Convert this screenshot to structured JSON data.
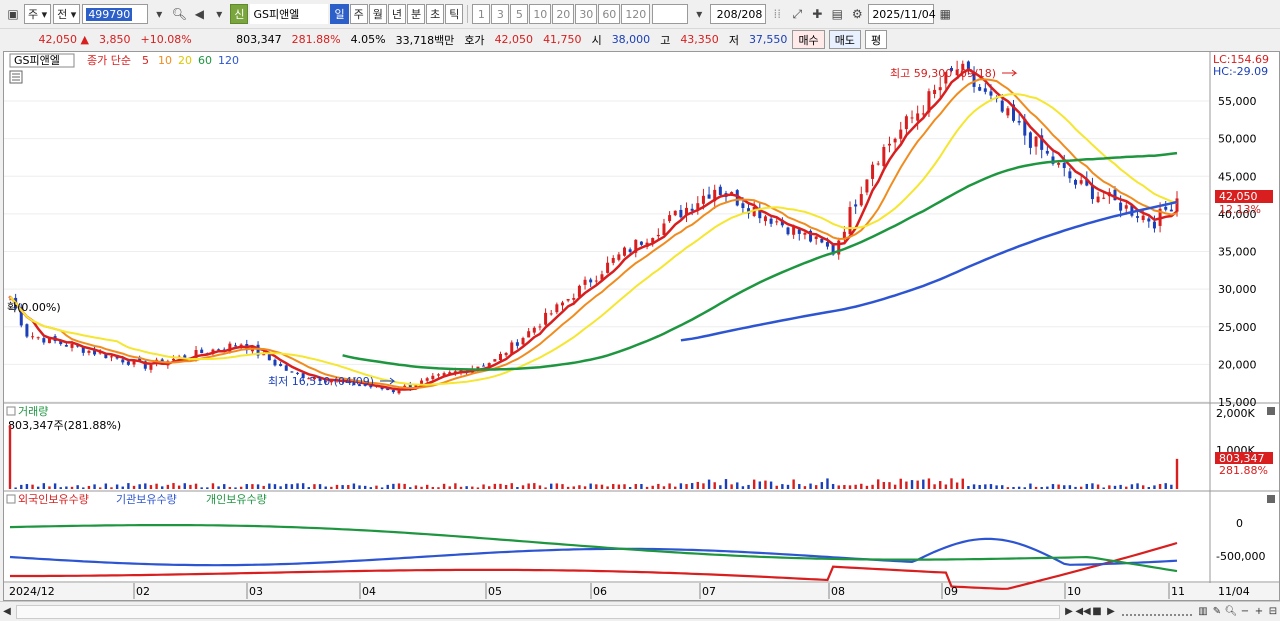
{
  "toolbar": {
    "period_btn": "주",
    "market_btn": "전",
    "stock_code": "499790",
    "new_badge": "신",
    "stock_name": "GS피앤엘",
    "tf_buttons": [
      {
        "label": "일",
        "active": true
      },
      {
        "label": "주",
        "active": false
      },
      {
        "label": "월",
        "active": false
      },
      {
        "label": "년",
        "active": false
      },
      {
        "label": "분",
        "active": false
      },
      {
        "label": "초",
        "active": false
      },
      {
        "label": "틱",
        "active": false
      }
    ],
    "intervals": [
      "1",
      "3",
      "5",
      "10",
      "20",
      "30",
      "60",
      "120"
    ],
    "count": "208",
    "total": "/208",
    "date": "2025/11/04"
  },
  "quote": {
    "price": "42,050",
    "up_mark": "▲",
    "change": "3,850",
    "change_pct": "+10.08%",
    "volume": "803,347",
    "vol_ratio": "281.88%",
    "turnover": "4.05%",
    "amount": "33,718백만",
    "ask_label": "호가",
    "ask": "42,050",
    "bid": "41,750",
    "open_label": "시",
    "open": "38,000",
    "high_label": "고",
    "high": "43,350",
    "low_label": "저",
    "low": "37,550",
    "buy_label": "매수",
    "sell_label": "매도",
    "avg_label": "평"
  },
  "chart": {
    "price_title": "GS피앤엘",
    "ma_label": "종가 단순",
    "ma_periods": [
      "5",
      "10",
      "20",
      "60",
      "120"
    ],
    "lc": "LC:154.69",
    "hc": "HC:-29.09",
    "y_ticks": [
      "55,000",
      "50,000",
      "45,000",
      "40,000",
      "35,000",
      "30,000",
      "25,000",
      "20,000",
      "15,000"
    ],
    "price_tag": "42,050",
    "pct_tag": "12.13%",
    "max_label": "최고 59,300 (09/18)",
    "min_label": "최저 16,510 (04/09)",
    "left_label": "확(0.00%)",
    "vol_title": "거래량",
    "vol_value": "803,347주(281.88%)",
    "vol_ticks": [
      "2,000K",
      "1,000K"
    ],
    "vol_tag": "803,347",
    "vol_pct_tag": "281.88%",
    "inv_labels": [
      "외국인보유수량",
      "기관보유수량",
      "개인보유수량"
    ],
    "inv_ticks": [
      "0",
      "-500,000"
    ],
    "x_labels": [
      "2024/12",
      "02",
      "03",
      "04",
      "05",
      "06",
      "07",
      "08",
      "09",
      "10",
      "11",
      "11/04"
    ]
  },
  "colors": {
    "ma5": "#d81e1e",
    "ma10": "#f08c1e",
    "ma20": "#f5e630",
    "ma60": "#1e9640",
    "ma120": "#2d55d2",
    "up": "#d81e1e",
    "down": "#1a3fb8"
  },
  "chart_data": {
    "type": "candlestick",
    "price_range": [
      14000,
      59300
    ],
    "price_waypoints": [
      {
        "date": "2024/12",
        "value": 29000
      },
      {
        "date": "2024/12",
        "value": 24000
      },
      {
        "date": "02",
        "value": 19800
      },
      {
        "date": "03",
        "value": 22800
      },
      {
        "date": "03",
        "value": 18800
      },
      {
        "date": "04/09",
        "value": 16510
      },
      {
        "date": "05",
        "value": 20500
      },
      {
        "date": "06",
        "value": 33800
      },
      {
        "date": "07",
        "value": 43500
      },
      {
        "date": "08",
        "value": 35000
      },
      {
        "date": "08",
        "value": 47000
      },
      {
        "date": "09/18",
        "value": 59300
      },
      {
        "date": "10",
        "value": 44000
      },
      {
        "date": "10",
        "value": 39000
      },
      {
        "date": "11/04",
        "value": 42050
      }
    ],
    "volume_last": 803347,
    "volume_range": [
      0,
      2000000
    ]
  }
}
